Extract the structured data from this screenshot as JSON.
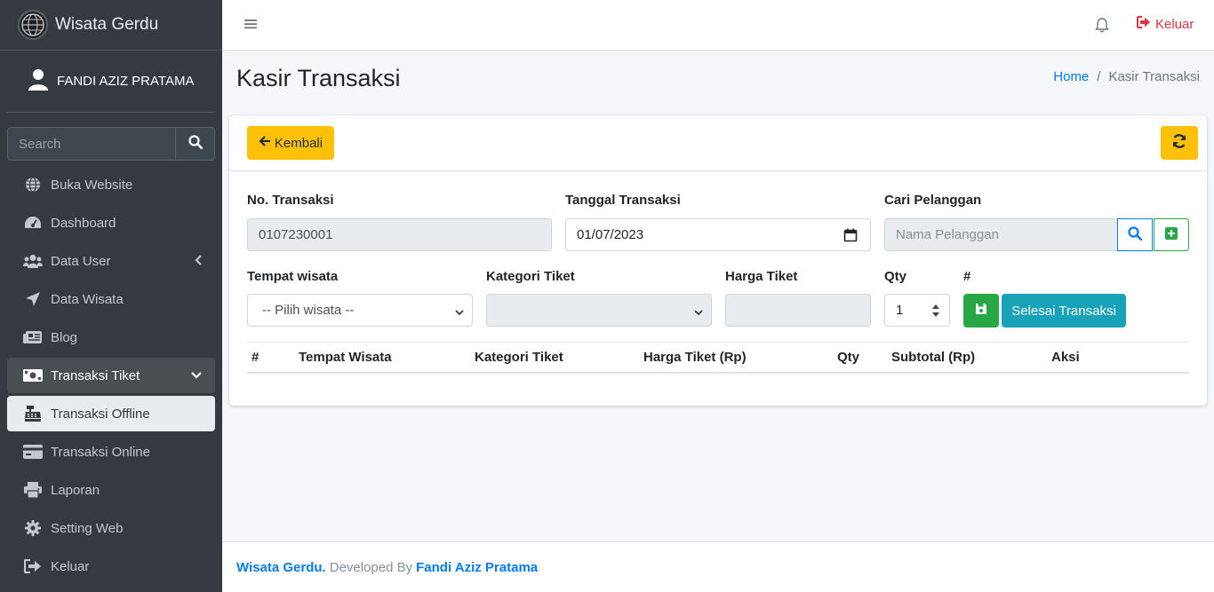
{
  "brand": {
    "name": "Wisata Gerdu"
  },
  "user": {
    "name": "FANDI AZIZ PRATAMA"
  },
  "search": {
    "placeholder": "Search"
  },
  "nav": [
    {
      "label": "Buka Website",
      "icon": "globe-icon"
    },
    {
      "label": "Dashboard",
      "icon": "gauge-icon"
    },
    {
      "label": "Data User",
      "icon": "users-icon"
    },
    {
      "label": "Data Wisata",
      "icon": "paper-plane-icon"
    },
    {
      "label": "Blog",
      "icon": "newspaper-icon"
    },
    {
      "label": "Transaksi Tiket",
      "icon": "money-bill-icon"
    },
    {
      "label": "Transaksi Offline",
      "icon": "cash-register-icon"
    },
    {
      "label": "Transaksi Online",
      "icon": "credit-card-icon"
    },
    {
      "label": "Laporan",
      "icon": "printer-icon"
    },
    {
      "label": "Setting Web",
      "icon": "gear-icon"
    },
    {
      "label": "Keluar",
      "icon": "sign-out-icon"
    }
  ],
  "topbar": {
    "logout_label": "Keluar"
  },
  "page": {
    "title": "Kasir Transaksi",
    "breadcrumb": {
      "home": "Home",
      "current": "Kasir Transaksi"
    }
  },
  "form": {
    "back_label": "Kembali",
    "no_transaksi_label": "No. Transaksi",
    "no_transaksi_value": "0107230001",
    "tanggal_label": "Tanggal Transaksi",
    "tanggal_value": "01/07/2023",
    "pelanggan_label": "Cari Pelanggan",
    "pelanggan_placeholder": "Nama Pelanggan",
    "tempat_label": "Tempat wisata",
    "tempat_value": "-- Pilih wisata --",
    "kategori_label": "Kategori Tiket",
    "harga_label": "Harga Tiket",
    "qty_label": "Qty",
    "qty_value": "1",
    "hash_label": "#",
    "finish_label": "Selesai Transaksi"
  },
  "table": {
    "headers": [
      "#",
      "Tempat Wisata",
      "Kategori Tiket",
      "Harga Tiket (Rp)",
      "Qty",
      "Subtotal (Rp)",
      "Aksi"
    ],
    "rows": []
  },
  "footer": {
    "brand": "Wisata Gerdu.",
    "developed": "Developed By",
    "author": "Fandi Aziz Pratama"
  },
  "colors": {
    "sidebar": "#343a40",
    "primary": "#007bff",
    "warning": "#ffc107",
    "success": "#28a745",
    "info": "#17a2b8",
    "danger": "#dc3545"
  }
}
